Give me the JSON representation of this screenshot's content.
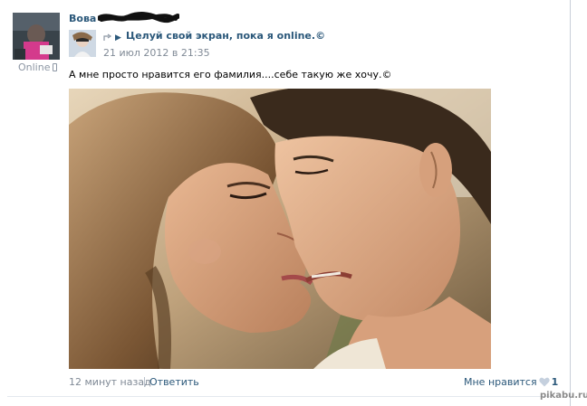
{
  "post": {
    "author_name": "Вова",
    "author_status": "Online",
    "repost": {
      "group_title": "Целуй свой экран, пока я online.©",
      "date": "21 июл 2012 в 21:35"
    },
    "text": "А мне просто нравится его фамилия....себе такую же хочу.©",
    "footer": {
      "timestamp": "12 минут назад",
      "reply_label": "Ответить",
      "like_label": "Мне нравится",
      "like_count": "1"
    }
  },
  "watermark": "pikabu.ru",
  "colors": {
    "link_blue": "#2b587a",
    "meta_gray": "#808a96",
    "online_gray": "#8c96a3",
    "heart_gray": "#c5d0de"
  },
  "icons": {
    "share": "share-arrow-icon",
    "play": "play-triangle-icon",
    "phone": "mobile-phone-icon",
    "heart": "heart-icon"
  }
}
